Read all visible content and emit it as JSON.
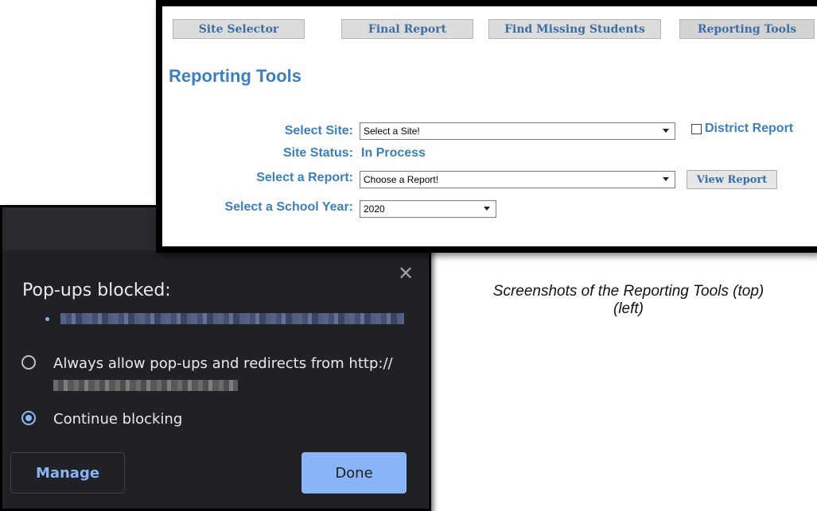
{
  "popup": {
    "title": "Pop-ups blocked:",
    "close_glyph": "✕",
    "options": [
      {
        "label": "Always allow pop-ups and redirects from http://",
        "selected": false
      },
      {
        "label": "Continue blocking",
        "selected": true
      }
    ],
    "manage_label": "Manage",
    "done_label": "Done",
    "accent": "#8ab4f8",
    "background": "#202124"
  },
  "report": {
    "tabs": [
      "Site Selector",
      "Final Report",
      "Find Missing Students",
      "Reporting Tools"
    ],
    "active_tab": "Reporting Tools",
    "heading": "Reporting Tools",
    "select_site_label": "Select Site:",
    "select_site_value": "Select a Site!",
    "district_report_label": "District Report",
    "district_report_checked": false,
    "site_status_label": "Site Status:",
    "site_status_value": "In Process",
    "select_report_label": "Select a Report:",
    "select_report_value": "Choose a Report!",
    "view_report_label": "View Report",
    "select_year_label": "Select a School Year:",
    "select_year_value": "2020",
    "label_color": "#3c7fbf"
  },
  "caption": {
    "line1": "Screenshots of the Reporting Tools (top)",
    "line2": "(left)"
  }
}
